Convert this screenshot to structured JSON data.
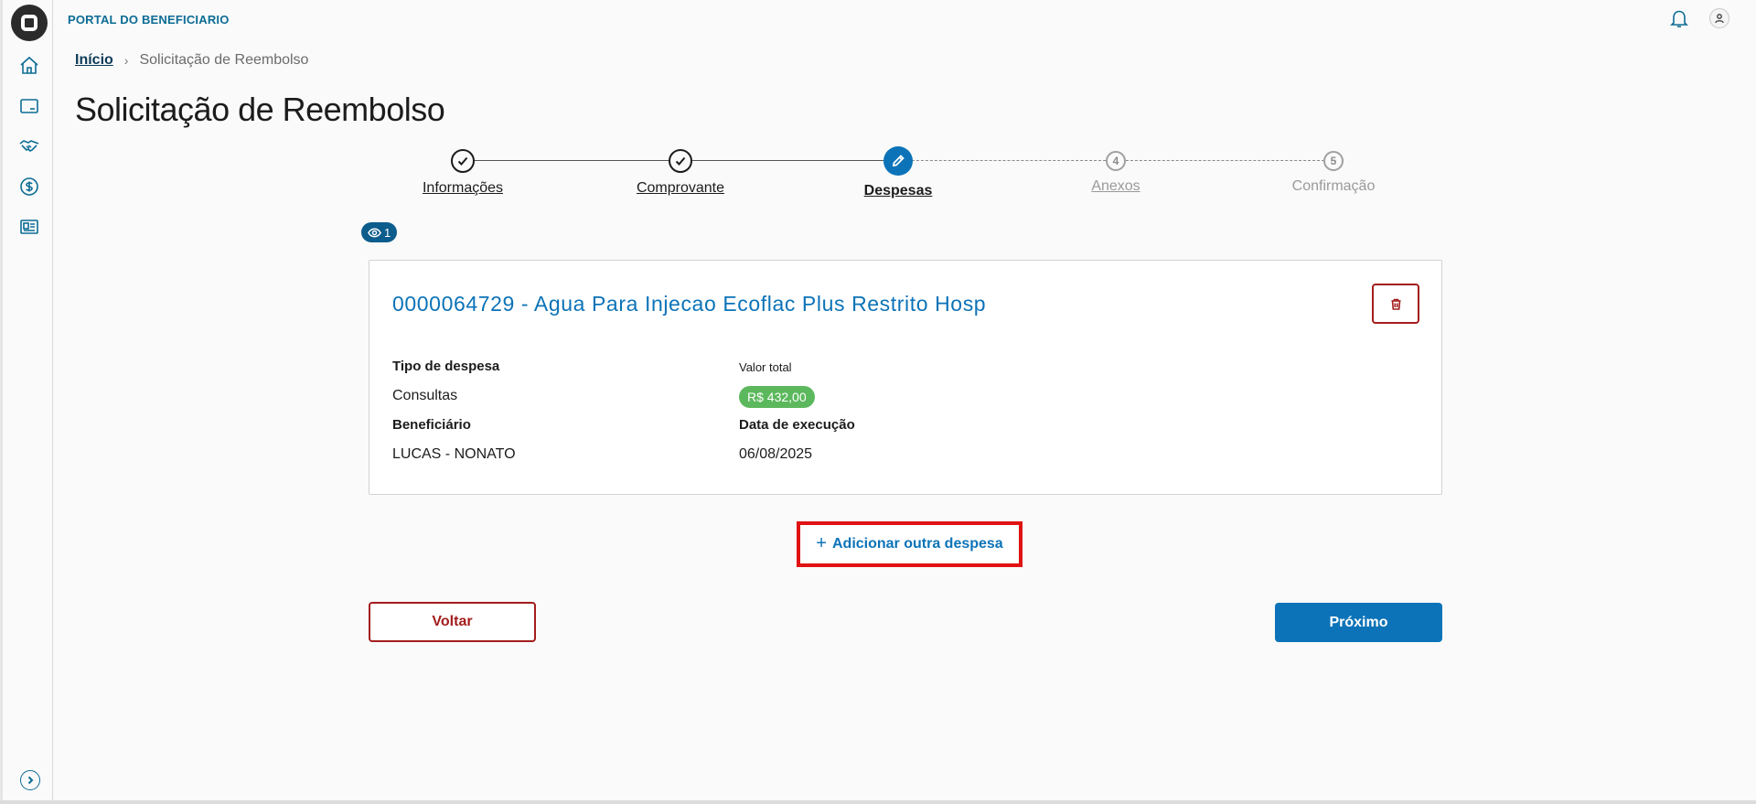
{
  "header": {
    "portal_title": "PORTAL DO BENEFICIARIO",
    "icons": [
      "bell-icon",
      "user-icon"
    ]
  },
  "sidebar": {
    "items": [
      {
        "name": "home",
        "icon": "home-icon"
      },
      {
        "name": "card",
        "icon": "card-icon"
      },
      {
        "name": "handshake",
        "icon": "handshake-icon"
      },
      {
        "name": "money",
        "icon": "dollar-icon"
      },
      {
        "name": "id-card",
        "icon": "id-card-icon"
      }
    ],
    "expand_icon": "chevron-right-icon"
  },
  "breadcrumb": {
    "home": "Início",
    "current": "Solicitação de Reembolso"
  },
  "page": {
    "title": "Solicitação de Reembolso"
  },
  "stepper": {
    "steps": [
      {
        "label": "Informações",
        "state": "done"
      },
      {
        "label": "Comprovante",
        "state": "done"
      },
      {
        "label": "Despesas",
        "state": "active"
      },
      {
        "label": "Anexos",
        "number": "4",
        "state": "pending"
      },
      {
        "label": "Confirmação",
        "number": "5",
        "state": "pending"
      }
    ]
  },
  "counter": {
    "value": "1"
  },
  "expense": {
    "title": "0000064729 - Agua Para Injecao Ecoflac Plus Restrito Hosp",
    "tipo_label": "Tipo de despesa",
    "tipo_value": "Consultas",
    "valor_label": "Valor total",
    "valor_value": "R$ 432,00",
    "beneficiario_label": "Beneficiário",
    "beneficiario_value": "LUCAS - NONATO",
    "data_label": "Data de execução",
    "data_value": "06/08/2025"
  },
  "actions": {
    "add_label": "Adicionar outra despesa",
    "back_label": "Voltar",
    "next_label": "Próximo"
  },
  "colors": {
    "primary": "#0c73b8",
    "danger": "#a31d1d",
    "success": "#5cb85c",
    "highlight": "#e01212"
  }
}
